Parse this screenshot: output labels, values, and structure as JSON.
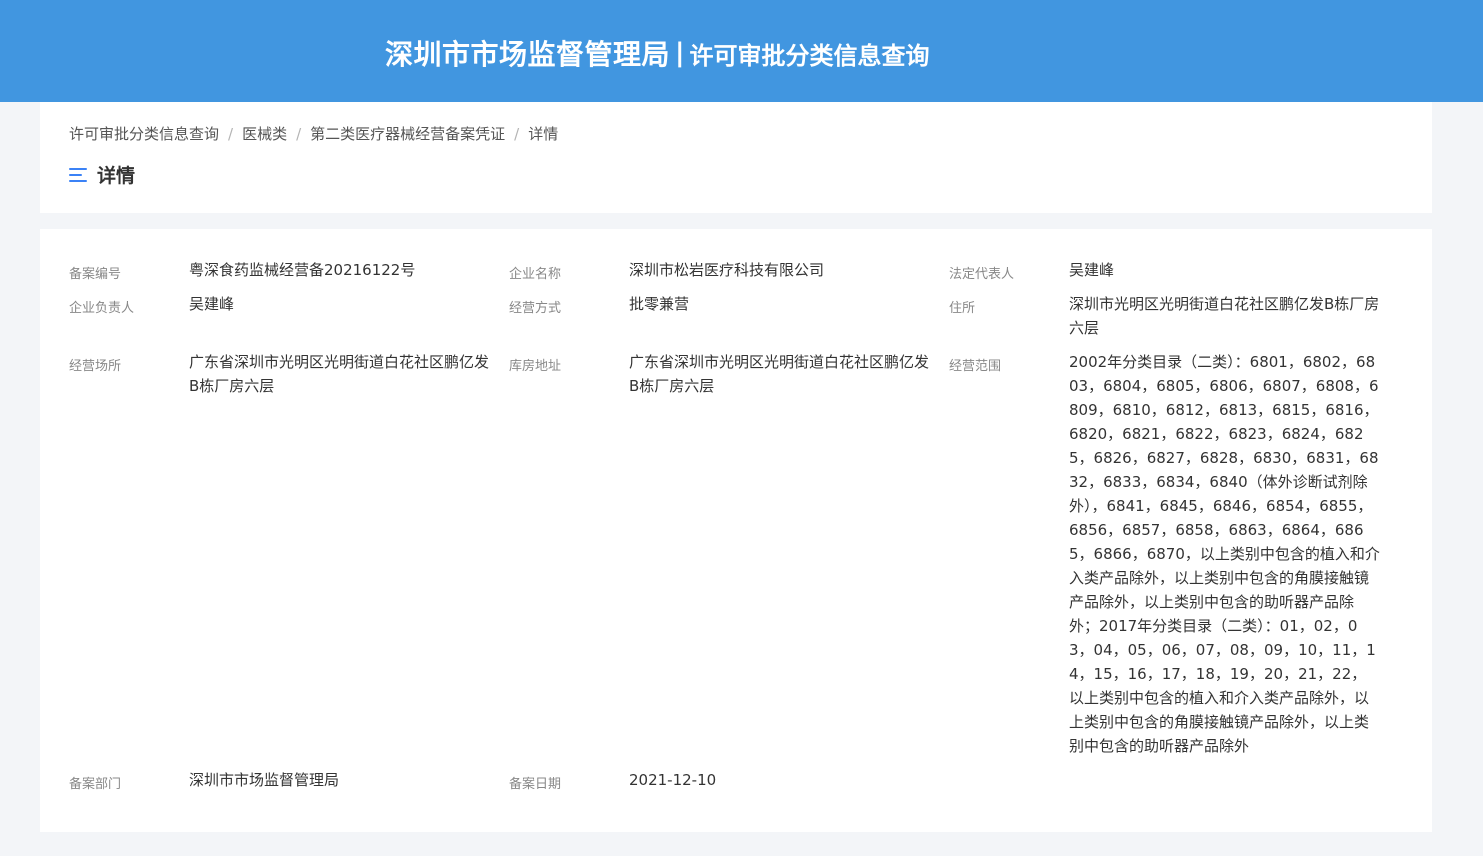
{
  "header": {
    "title_main": "深圳市市场监督管理局",
    "separator": "|",
    "title_sub": "许可审批分类信息查询"
  },
  "breadcrumb": {
    "items": [
      "许可审批分类信息查询",
      "医械类",
      "第二类医疗器械经营备案凭证",
      "详情"
    ],
    "separator": "/"
  },
  "page": {
    "heading": "详情"
  },
  "details": {
    "record_no_label": "备案编号",
    "record_no": "粤深食药监械经营备20216122号",
    "company_name_label": "企业名称",
    "company_name": "深圳市松岩医疗科技有限公司",
    "legal_rep_label": "法定代表人",
    "legal_rep": "吴建峰",
    "principal_label": "企业负责人",
    "principal": "吴建峰",
    "business_mode_label": "经营方式",
    "business_mode": "批零兼营",
    "residence_label": "住所",
    "residence": "深圳市光明区光明街道白花社区鹏亿发B栋厂房六层",
    "premises_label": "经营场所",
    "premises": "广东省深圳市光明区光明街道白花社区鹏亿发B栋厂房六层",
    "warehouse_label": "库房地址",
    "warehouse": "广东省深圳市光明区光明街道白花社区鹏亿发B栋厂房六层",
    "scope_label": "经营范围",
    "scope": "2002年分类目录（二类）：6801，6802，6803，6804，6805，6806，6807，6808，6809，6810，6812，6813，6815，6816，6820，6821，6822，6823，6824，6825，6826，6827，6828，6830，6831，6832，6833，6834，6840（体外诊断试剂除外），6841，6845，6846，6854，6855，6856，6857，6858，6863，6864，6865，6866，6870，以上类别中包含的植入和介入类产品除外，以上类别中包含的角膜接触镜产品除外，以上类别中包含的助听器产品除外；2017年分类目录（二类）：01，02，03，04，05，06，07，08，09，10，11，14，15，16，17，18，19，20，21，22，以上类别中包含的植入和介入类产品除外，以上类别中包含的角膜接触镜产品除外，以上类别中包含的助听器产品除外",
    "dept_label": "备案部门",
    "dept": "深圳市市场监督管理局",
    "date_label": "备案日期",
    "date": "2021-12-10"
  }
}
